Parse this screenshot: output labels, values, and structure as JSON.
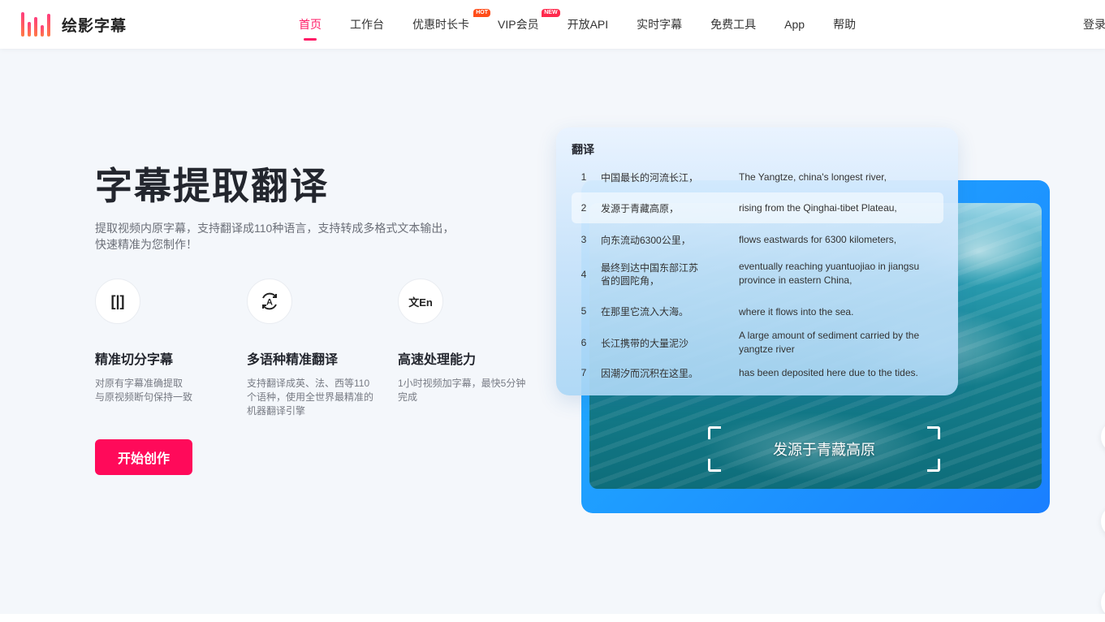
{
  "brand": {
    "name": "绘影字幕"
  },
  "nav": [
    {
      "label": "首页",
      "active": true
    },
    {
      "label": "工作台"
    },
    {
      "label": "优惠时长卡",
      "badge": "HOT"
    },
    {
      "label": "VIP会员",
      "badge": "NEW"
    },
    {
      "label": "开放API"
    },
    {
      "label": "实时字幕"
    },
    {
      "label": "免费工具"
    },
    {
      "label": "App"
    },
    {
      "label": "帮助"
    }
  ],
  "login_label": "登录",
  "hero": {
    "title": "字幕提取翻译",
    "desc_line1": "提取视频内原字幕，支持翻译成110种语言，支持转成多格式文本输出，",
    "desc_line2": "快速精准为您制作！",
    "start_label": "开始创作"
  },
  "features": [
    {
      "icon": "split-subtitle-icon",
      "glyph": "[|]",
      "title": "精准切分字幕",
      "desc_line1": "对原有字幕准确提取",
      "desc_line2": "与原视频断句保持一致",
      "desc_line3": ""
    },
    {
      "icon": "translate-cycle-icon",
      "glyph": "A",
      "title": "多语种精准翻译",
      "desc_line1": "支持翻译成英、法、西等110",
      "desc_line2": "个语种，使用全世界最精准的",
      "desc_line3": "机器翻译引擎"
    },
    {
      "icon": "zh-en-icon",
      "glyph": "文En",
      "title": "高速处理能力",
      "desc_line1": "1小时视频加字幕，最快5分钟",
      "desc_line2": "完成",
      "desc_line3": ""
    }
  ],
  "translation_panel": {
    "title": "翻译",
    "rows": [
      {
        "num": "1",
        "zh": "中国最长的河流长江，",
        "en": "The Yangtze, china's longest river,"
      },
      {
        "num": "2",
        "zh": "发源于青藏高原，",
        "en": "rising from the Qinghai-tibet Plateau,"
      },
      {
        "num": "3",
        "zh": "向东流动6300公里，",
        "en": "flows eastwards for 6300 kilometers,"
      },
      {
        "num": "4",
        "zh": "最终到达中国东部江苏省的圆陀角，",
        "en": "eventually reaching yuantuojiao in jiangsu province in eastern China,"
      },
      {
        "num": "5",
        "zh": "在那里它流入大海。",
        "en": "where it flows into the sea."
      },
      {
        "num": "6",
        "zh": "长江携带的大量泥沙",
        "en": "A large amount of sediment carried by the yangtze river"
      },
      {
        "num": "7",
        "zh": "因潮汐而沉积在这里。",
        "en": "has been deposited here due to the tides."
      }
    ]
  },
  "video": {
    "subtitle": "发源于青藏高原"
  },
  "colors": {
    "accent": "#ff0a5a",
    "nav_active": "#ff1a66",
    "video_frame": "#1a8cff"
  }
}
